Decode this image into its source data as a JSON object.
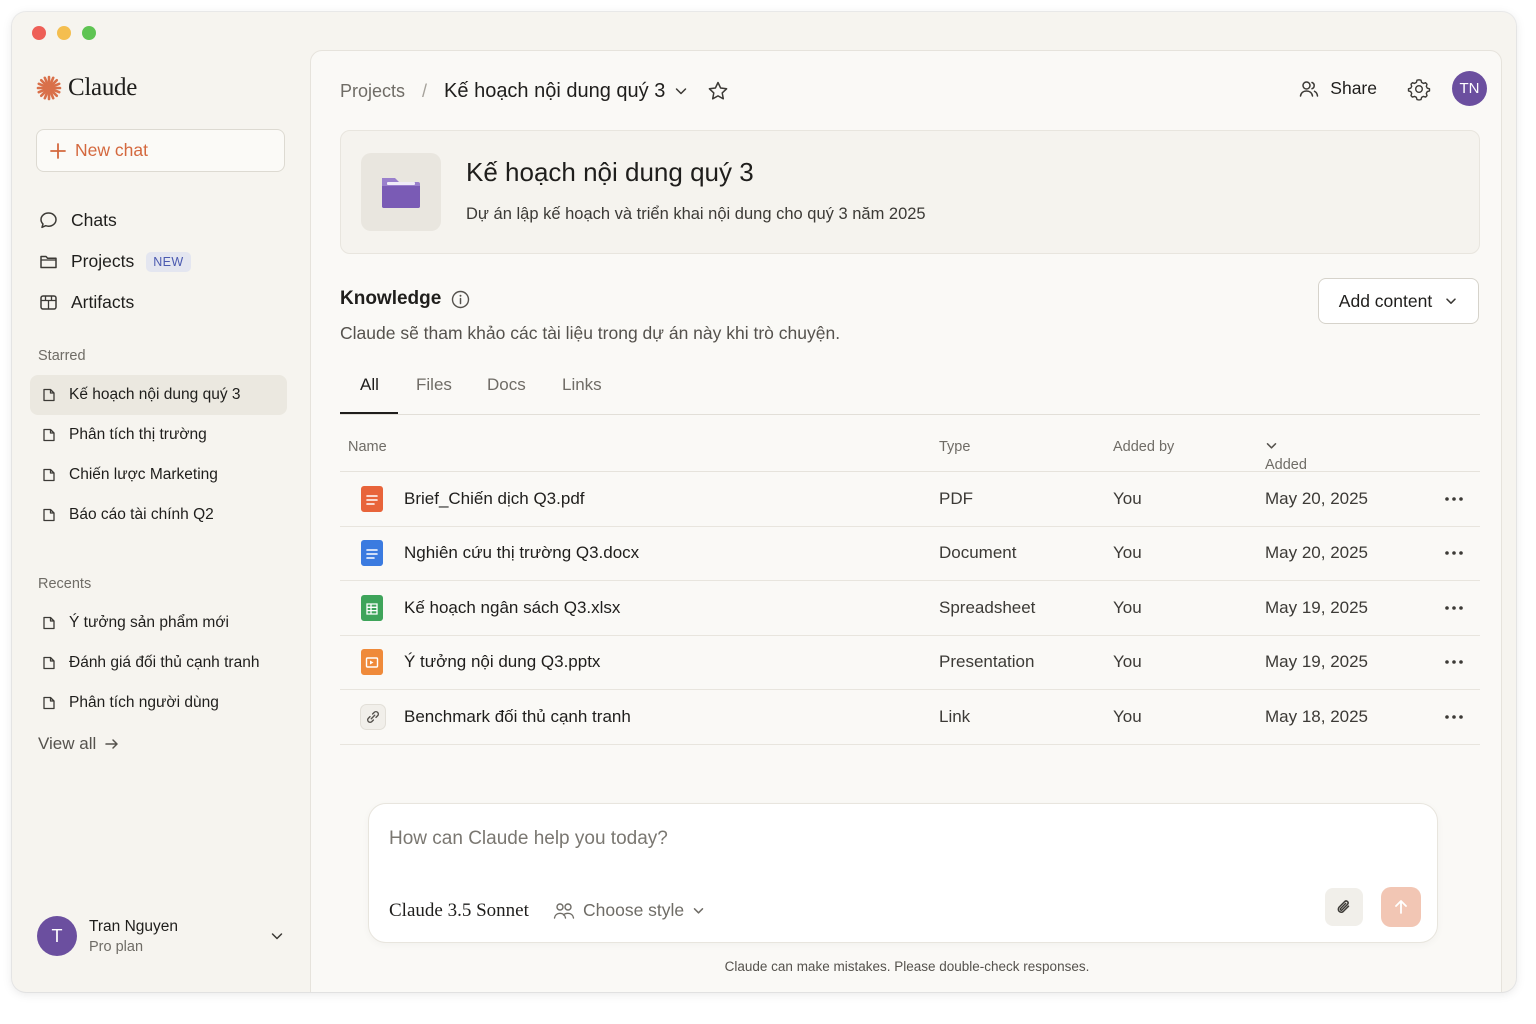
{
  "app": {
    "brand": "Claude"
  },
  "sidebar": {
    "new_chat": "New chat",
    "nav": [
      {
        "label": "Chats",
        "icon": "chat-bubble-icon"
      },
      {
        "label": "Projects",
        "icon": "folder-icon",
        "badge": "NEW"
      },
      {
        "label": "Artifacts",
        "icon": "artifact-box-icon"
      }
    ],
    "starred_label": "Starred",
    "starred": [
      {
        "label": "Kế hoạch nội dung quý 3",
        "active": true
      },
      {
        "label": "Phân tích thị trường"
      },
      {
        "label": "Chiến lược Marketing"
      },
      {
        "label": "Báo cáo tài chính Q2"
      }
    ],
    "recents_label": "Recents",
    "recents": [
      {
        "label": "Ý tưởng sản phẩm mới"
      },
      {
        "label": "Đánh giá đối thủ cạnh tranh"
      },
      {
        "label": "Phân tích người dùng"
      }
    ],
    "view_all": "View all",
    "user": {
      "initial": "T",
      "name": "Tran Nguyen",
      "plan": "Pro plan"
    }
  },
  "header": {
    "breadcrumb_root": "Projects",
    "breadcrumb_sep": "/",
    "breadcrumb_current": "Kế hoạch nội dung quý 3",
    "share": "Share",
    "avatar_initials": "TN"
  },
  "project": {
    "title": "Kế hoạch nội dung quý 3",
    "description": "Dự án lập kế hoạch và triển khai nội dung cho quý 3 năm 2025"
  },
  "knowledge": {
    "title": "Knowledge",
    "description": "Claude sẽ tham khảo các tài liệu trong dự án này khi trò chuyện.",
    "add_content": "Add content",
    "tabs": [
      "All",
      "Files",
      "Docs",
      "Links"
    ],
    "columns": {
      "name": "Name",
      "type": "Type",
      "added_by": "Added by",
      "added": "Added"
    },
    "rows": [
      {
        "name": "Brief_Chiến dịch Q3.pdf",
        "type": "PDF",
        "added_by": "You",
        "added": "May 20, 2025",
        "icon": "pdf-file-icon",
        "color": "#e8643a"
      },
      {
        "name": "Nghiên cứu thị trường Q3.docx",
        "type": "Document",
        "added_by": "You",
        "added": "May 20, 2025",
        "icon": "document-file-icon",
        "color": "#3b7be0"
      },
      {
        "name": "Kế hoạch ngân sách Q3.xlsx",
        "type": "Spreadsheet",
        "added_by": "You",
        "added": "May 19, 2025",
        "icon": "spreadsheet-file-icon",
        "color": "#3ea45a"
      },
      {
        "name": "Ý tưởng nội dung Q3.pptx",
        "type": "Presentation",
        "added_by": "You",
        "added": "May 19, 2025",
        "icon": "presentation-file-icon",
        "color": "#ef8a3a"
      },
      {
        "name": "Benchmark đối thủ cạnh tranh",
        "type": "Link",
        "added_by": "You",
        "added": "May 18, 2025",
        "icon": "link-icon",
        "color": "#6f6c66"
      }
    ]
  },
  "composer": {
    "placeholder": "How can Claude help you today?",
    "model": "Claude 3.5 Sonnet",
    "style": "Choose style",
    "disclaimer": "Claude can make mistakes. Please double-check responses."
  },
  "colors": {
    "accent": "#d4683e",
    "avatar": "#6b4f9f",
    "folder": "#7a5bb5"
  }
}
